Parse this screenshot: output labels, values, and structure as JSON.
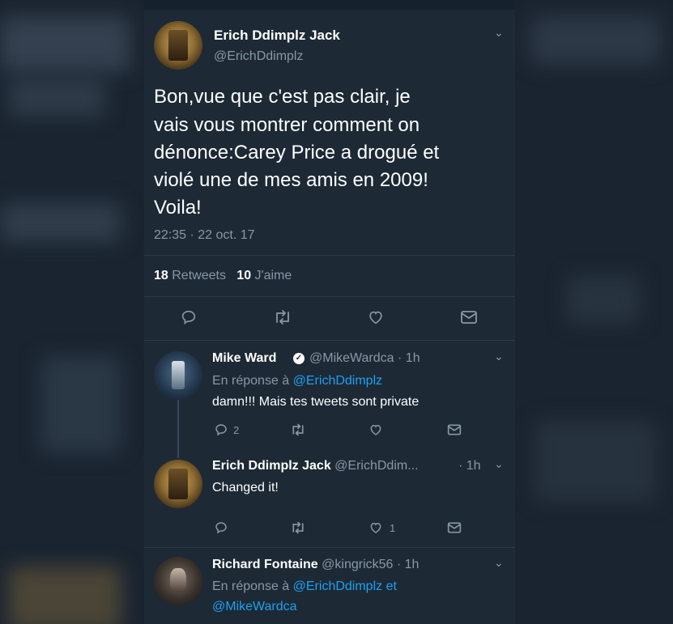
{
  "main_tweet": {
    "display_name": "Erich Ddimplz Jack",
    "handle": "@ErichDdimplz",
    "text_lines": [
      "Bon,vue que c'est pas clair, je",
      "vais vous montrer comment on",
      "dénonce:Carey Price a drogué et",
      "violé une de mes amis en 2009!",
      "Voila!"
    ],
    "timestamp": "22:35 · 22 oct. 17",
    "retweet_count": "18",
    "retweet_label": "Retweets",
    "like_count": "10",
    "like_label": "J'aime"
  },
  "replies": [
    {
      "display_name": "Mike Ward",
      "verified": true,
      "handle": "@MikeWardca",
      "time": "· 1h",
      "reply_prefix": "En réponse à",
      "reply_to": "@ErichDdimplz",
      "text": "damn!!! Mais tes tweets sont private",
      "reply_count": "2",
      "like_count": ""
    },
    {
      "display_name": "Erich Ddimplz Jack",
      "handle": "@ErichDdim...",
      "time": "· 1h",
      "text": "Changed it!",
      "reply_count": "",
      "like_count": "1"
    },
    {
      "display_name": "Richard Fontaine",
      "handle": "@kingrick56",
      "time": "· 1h",
      "reply_prefix": "En réponse à",
      "reply_to": "@ErichDdimplz et",
      "reply_to_2": "@MikeWardca"
    }
  ],
  "icons": [
    "chevron-down-icon",
    "reply-icon",
    "retweet-icon",
    "like-icon",
    "direct-message-icon",
    "verified-badge-icon"
  ],
  "colors": {
    "background": "#1d2935",
    "text": "#ffffff",
    "muted": "#8899a6",
    "link": "#1da1f2"
  }
}
